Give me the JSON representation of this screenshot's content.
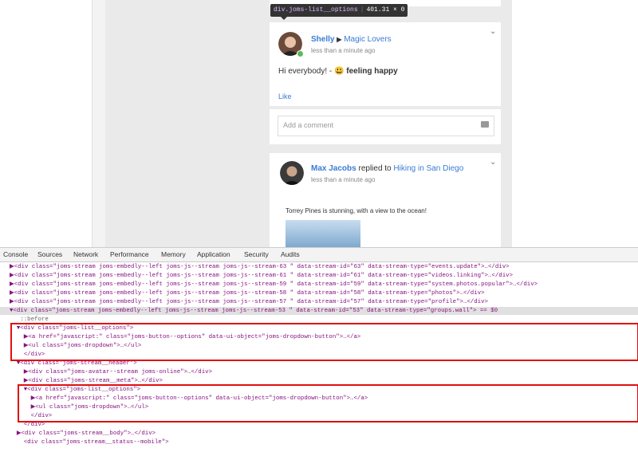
{
  "tooltip": {
    "element": "div.joms-list__options",
    "size": "401.31 × 0"
  },
  "post1": {
    "author": "Shelly",
    "arrow": "▶",
    "target": "Magic Lovers",
    "time": "less than a minute ago",
    "message": "Hi everybody! -",
    "emoji": "😃",
    "feeling": "feeling happy",
    "like_label": "Like",
    "comment_placeholder": "Add a comment"
  },
  "post2": {
    "author": "Max Jacobs",
    "verb": "replied to",
    "target_a": "Hiking",
    "target_in": "in",
    "target_b": "San Diego",
    "time": "less than a minute ago",
    "message": "Torrey Pines is stunning, with a view to the ocean!"
  },
  "devtools": {
    "tabs": [
      "Console",
      "Sources",
      "Network",
      "Performance",
      "Memory",
      "Application",
      "Security",
      "Audits"
    ],
    "lines": [
      "▶<div class=\"joms-stream joms-embedly--left joms-js--stream joms-js--stream-63 \" data-stream-id=\"63\" data-stream-type=\"events.update\">…</div>",
      "▶<div class=\"joms-stream joms-embedly--left joms-js--stream joms-js--stream-61 \" data-stream-id=\"61\" data-stream-type=\"videos.linking\">…</div>",
      "▶<div class=\"joms-stream joms-embedly--left joms-js--stream joms-js--stream-59 \" data-stream-id=\"59\" data-stream-type=\"system.photos.popular\">…</div>",
      "▶<div class=\"joms-stream joms-embedly--left joms-js--stream joms-js--stream-58 \" data-stream-id=\"58\" data-stream-type=\"photos\">…</div>",
      "▶<div class=\"joms-stream joms-embedly--left joms-js--stream joms-js--stream-57 \" data-stream-id=\"57\" data-stream-type=\"profile\">…</div>",
      "▼<div class=\"joms-stream joms-embedly--left joms-js--stream joms-js--stream-53 \" data-stream-id=\"53\" data-stream-type=\"groups.wall\"> == $0",
      "   ::before",
      "  ▼<div class=\"joms-list__options\">",
      "    ▶<a href=\"javascript:\" class=\"joms-button--options\" data-ui-object=\"joms-dropdown-button\">…</a>",
      "    ▶<ul class=\"joms-dropdown\">…</ul>",
      "    </div>",
      "  ▼<div class=\"joms-stream__header\">",
      "    ▶<div class=\"joms-avatar--stream joms-online\">…</div>",
      "    ▶<div class=\"joms-stream__meta\">…</div>",
      "    ▼<div class=\"joms-list__options\">",
      "      ▶<a href=\"javascript:\" class=\"joms-button--options\" data-ui-object=\"joms-dropdown-button\">…</a>",
      "      ▶<ul class=\"joms-dropdown\">…</ul>",
      "      </div>",
      "    </div>",
      "  ▶<div class=\"joms-stream__body\">…</div>",
      "    <div class=\"joms-stream__status--mobile\">"
    ]
  }
}
